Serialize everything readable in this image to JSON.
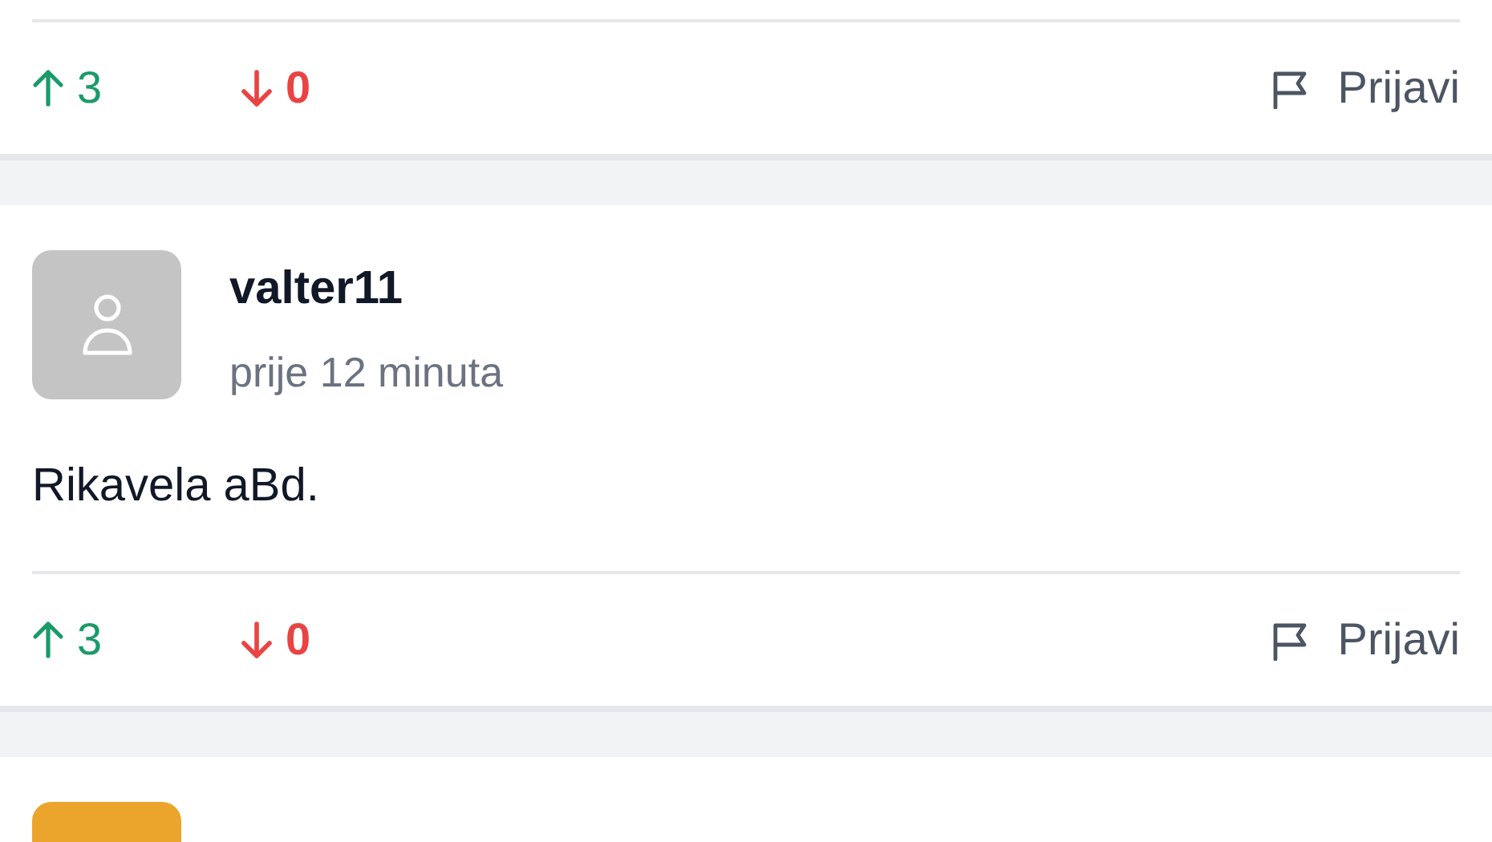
{
  "comments": [
    {
      "upvotes": "3",
      "downvotes": "0",
      "report": "Prijavi"
    },
    {
      "author": "valter11",
      "time": "prije 12 minuta",
      "avatar": {
        "kind": "placeholder",
        "color": "#c4c4c4"
      },
      "text": "Rikavela aBd.",
      "upvotes": "3",
      "downvotes": "0",
      "report": "Prijavi"
    },
    {
      "avatar": {
        "kind": "initial",
        "color": "#eba52d"
      }
    }
  ]
}
